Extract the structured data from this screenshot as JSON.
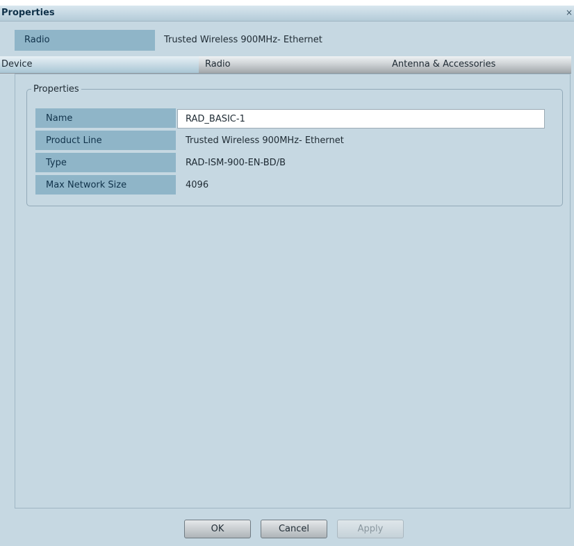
{
  "window": {
    "title": "Properties",
    "close_glyph": "×"
  },
  "header": {
    "label": "Radio",
    "value": "Trusted Wireless 900MHz- Ethernet"
  },
  "tabs": [
    {
      "label": "Device",
      "active": true
    },
    {
      "label": "Radio",
      "active": false
    },
    {
      "label": "Antenna & Accessories",
      "active": false
    }
  ],
  "group": {
    "legend": "Properties",
    "rows": [
      {
        "label": "Name",
        "value": "RAD_BASIC-1",
        "editable": true
      },
      {
        "label": "Product Line",
        "value": "Trusted Wireless 900MHz- Ethernet"
      },
      {
        "label": "Type",
        "value": "RAD-ISM-900-EN-BD/B"
      },
      {
        "label": "Max Network Size",
        "value": "4096"
      }
    ]
  },
  "buttons": {
    "ok": "OK",
    "cancel": "Cancel",
    "apply": "Apply"
  },
  "colors": {
    "background": "#c6d8e2",
    "label_cell": "#8fb5c8",
    "title_text": "#10324a"
  }
}
